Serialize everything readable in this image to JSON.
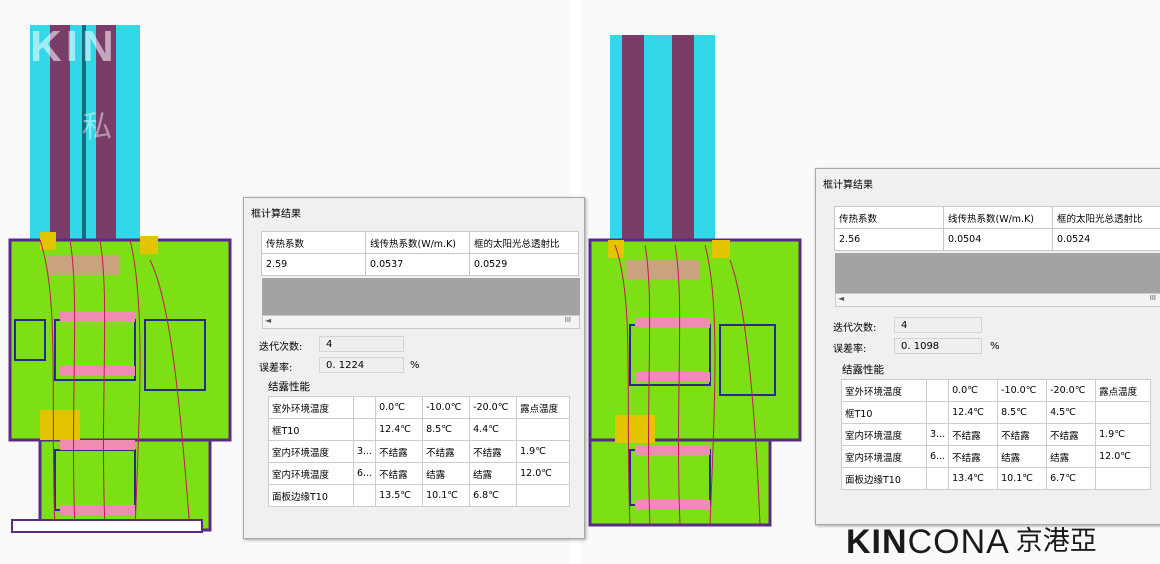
{
  "watermark": {
    "brand_faint": "KIN",
    "cn_faint": "私 "
  },
  "logo": {
    "bold": "KIN",
    "light": "CONA",
    "cn": "京港亞"
  },
  "results": [
    {
      "title": "框计算结果",
      "headers": [
        "传热系数",
        "线传热系数(W/m.K)",
        "框的太阳光总透射比"
      ],
      "values": [
        "2.59",
        "0.0537",
        "0.0529"
      ],
      "iteration_label": "迭代次数:",
      "iteration_value": "4",
      "error_label": "误差率:",
      "error_value": "0. 1224",
      "error_unit": "%",
      "condensation_title": "结露性能",
      "cond_header": [
        "室外环境温度",
        "",
        "0.0℃",
        "-10.0℃",
        "-20.0℃",
        "露点温度"
      ],
      "cond_rows": [
        [
          "框T10",
          "",
          "12.4℃",
          "8.5℃",
          "4.4℃",
          ""
        ],
        [
          "室内环境温度",
          "3...",
          "不结露",
          "不结露",
          "不结露",
          "1.9℃"
        ],
        [
          "室内环境温度",
          "6...",
          "不结露",
          "结露",
          "结露",
          "12.0℃"
        ],
        [
          "面板边缘T10",
          "",
          "13.5℃",
          "10.1℃",
          "6.8℃",
          ""
        ]
      ],
      "scroll_arrow": "◄",
      "scroll_grip": "III"
    },
    {
      "title": "框计算结果",
      "headers": [
        "传热系数",
        "线传热系数(W/m.K)",
        "框的太阳光总透射比"
      ],
      "values": [
        "2.56",
        "0.0504",
        "0.0524"
      ],
      "iteration_label": "迭代次数:",
      "iteration_value": "4",
      "error_label": "误差率:",
      "error_value": "0. 1098",
      "error_unit": "%",
      "condensation_title": "结露性能",
      "cond_header": [
        "室外环境温度",
        "",
        "0.0℃",
        "-10.0℃",
        "-20.0℃",
        "露点温度"
      ],
      "cond_rows": [
        [
          "框T10",
          "",
          "12.4℃",
          "8.5℃",
          "4.5℃",
          ""
        ],
        [
          "室内环境温度",
          "3...",
          "不结露",
          "不结露",
          "不结露",
          "1.9℃"
        ],
        [
          "室内环境温度",
          "6...",
          "不结露",
          "结露",
          "结露",
          "12.0℃"
        ],
        [
          "面板边缘T10",
          "",
          "13.4℃",
          "10.1℃",
          "6.7℃",
          ""
        ]
      ],
      "scroll_arrow": "◄",
      "scroll_grip": "III"
    }
  ],
  "colors": {
    "glass": "#32d7e8",
    "frame": "#7ce014",
    "isotherm": "#c2185b",
    "gasket": "#2a2a8e",
    "thermal_break": "#f08cb4"
  }
}
